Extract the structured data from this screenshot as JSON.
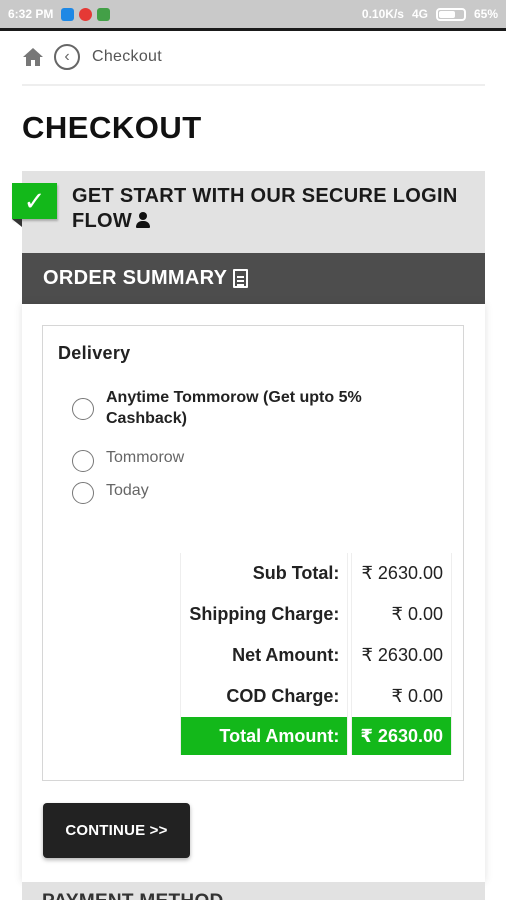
{
  "status_bar": {
    "time": "6:32 PM",
    "network_speed": "0.10K/s",
    "network_type": "4G",
    "battery": "65%"
  },
  "breadcrumb": {
    "home_icon": "home-icon",
    "back_icon": "chevron-left-icon",
    "label": "Checkout"
  },
  "page": {
    "title": "CHECKOUT"
  },
  "login_step": {
    "text": "GET START WITH OUR SECURE LOGIN FLOW",
    "status_icon": "checkmark-icon",
    "trailing_icon": "user-icon",
    "status_color": "#13b81a"
  },
  "order_summary": {
    "title": "ORDER SUMMARY",
    "title_icon": "document-icon",
    "header_color": "#4d4d4d"
  },
  "delivery": {
    "title": "Delivery",
    "options": [
      {
        "label": "Anytime Tommorow (Get upto 5% Cashback)",
        "selected": false
      },
      {
        "label": "Tommorow",
        "selected": false
      },
      {
        "label": "Today",
        "selected": false
      }
    ]
  },
  "totals": {
    "rows": [
      {
        "label": "Sub Total:",
        "value": "₹ 2630.00"
      },
      {
        "label": "Shipping Charge:",
        "value": "₹ 0.00"
      },
      {
        "label": "Net Amount:",
        "value": "₹ 2630.00"
      },
      {
        "label": "COD Charge:",
        "value": "₹ 0.00"
      }
    ],
    "grand": {
      "label": "Total Amount:",
      "value": "₹ 2630.00"
    },
    "highlight_color": "#13b81a"
  },
  "actions": {
    "continue_label": "CONTINUE >>"
  },
  "next_step": {
    "text": "PAYMENT METHOD"
  }
}
